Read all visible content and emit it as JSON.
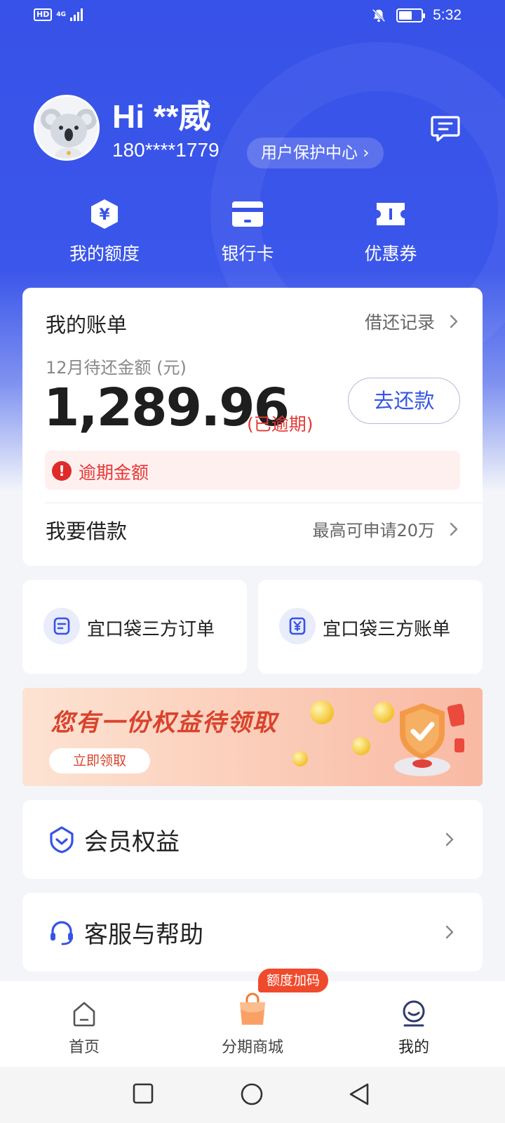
{
  "status_bar": {
    "hd_label": "HD",
    "network_label": "4G",
    "time": "5:32"
  },
  "profile": {
    "greeting": "Hi **威",
    "phone": "180****1779",
    "protect_center": "用户保护中心 ›"
  },
  "quick_links": [
    {
      "label": "我的额度",
      "icon": "yen-hexagon-icon"
    },
    {
      "label": "银行卡",
      "icon": "bank-card-icon"
    },
    {
      "label": "优惠券",
      "icon": "coupon-ticket-icon"
    }
  ],
  "bill": {
    "title": "我的账单",
    "record_link": "借还记录",
    "due_label": "12月待还金额 (元)",
    "amount": "1,289.96",
    "overdue_tag": "(已逾期)",
    "repay_button": "去还款",
    "overdue_notice": "逾期金额",
    "borrow_title": "我要借款",
    "borrow_hint": "最高可申请20万"
  },
  "third_party": [
    {
      "label": "宜口袋三方订单",
      "icon": "order-doc-icon"
    },
    {
      "label": "宜口袋三方账单",
      "icon": "yen-bill-icon"
    }
  ],
  "banner": {
    "title": "您有一份权益待领取",
    "button": "立即领取"
  },
  "menu": [
    {
      "label": "会员权益",
      "icon": "member-shield-icon"
    },
    {
      "label": "客服与帮助",
      "icon": "headset-icon"
    }
  ],
  "tabbar": {
    "tabs": [
      {
        "label": "首页",
        "icon": "home-icon"
      },
      {
        "label": "分期商城",
        "icon": "shopping-bag-icon"
      },
      {
        "label": "我的",
        "icon": "profile-smile-icon"
      }
    ],
    "badge": "额度加码",
    "active_tab": "我的"
  },
  "colors": {
    "brand_blue": "#3752e8",
    "overdue_red": "#e53935",
    "accent_blue_text": "#3556e5"
  }
}
